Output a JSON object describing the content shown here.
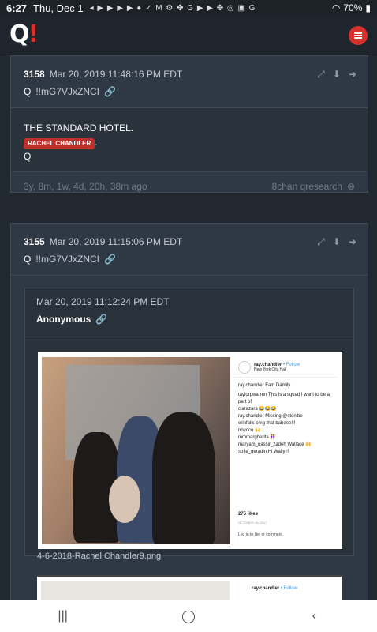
{
  "status": {
    "time": "6:27",
    "date": "Thu, Dec 1",
    "notif_icons": "◂ ▶ ▶ ▶ ▶ ● ✓ M ⚙ ✤ G ▶ ▶ ✤ ◎ ▣ G",
    "battery": "70%"
  },
  "app": {
    "logo_q": "Q",
    "logo_bang": "!"
  },
  "post1": {
    "num": "3158",
    "date": "Mar 20, 2019 11:48:16 PM EDT",
    "author": "Q",
    "trip": "!!mG7VJxZNCI",
    "line1": "THE STANDARD HOTEL.",
    "tag": "RACHEL CHANDLER",
    "tag_suffix": ".",
    "sign": "Q",
    "age": "3y, 8m, 1w, 4d, 20h, 38m ago",
    "source": "8chan qresearch"
  },
  "post2": {
    "num": "3155",
    "date": "Mar 20, 2019 11:15:06 PM EDT",
    "author": "Q",
    "trip": "!!mG7VJxZNCI",
    "quote_date": "Mar 20, 2019 11:12:24 PM EDT",
    "quote_author": "Anonymous",
    "filename": "4-6-2018-Rachel Chandler9.png"
  },
  "insta": {
    "user": "ray.chandler",
    "follow": "• Follow",
    "location": "New York City Hall",
    "comments": [
      "ray.chandler Fam Damily",
      "taylorpwarren This is a squad I want to be a part of.",
      "clarazara 😂😂😂",
      "ray.chandler Missing @stonibe",
      "erinfalls omg that babeee!!!",
      "noyoco 🙌",
      "mmmargherita 👭",
      "maryam_nassir_zadeh Wallace 🙌",
      "sofie_geradin Hi Wally!!!"
    ],
    "likes": "275 likes",
    "when": "OCTOBER 16, 2017",
    "login": "Log in to like or comment.",
    "user2": "ray.chandler",
    "follow2": "• Follow"
  },
  "icons": {
    "share": "share-icon",
    "download": "download-icon",
    "go": "arrow-right-circle-icon",
    "link": "link-icon",
    "close": "close-circle-icon"
  },
  "colors": {
    "accent": "#d9302c",
    "link": "#4a90d9",
    "panel": "#2f3945"
  }
}
